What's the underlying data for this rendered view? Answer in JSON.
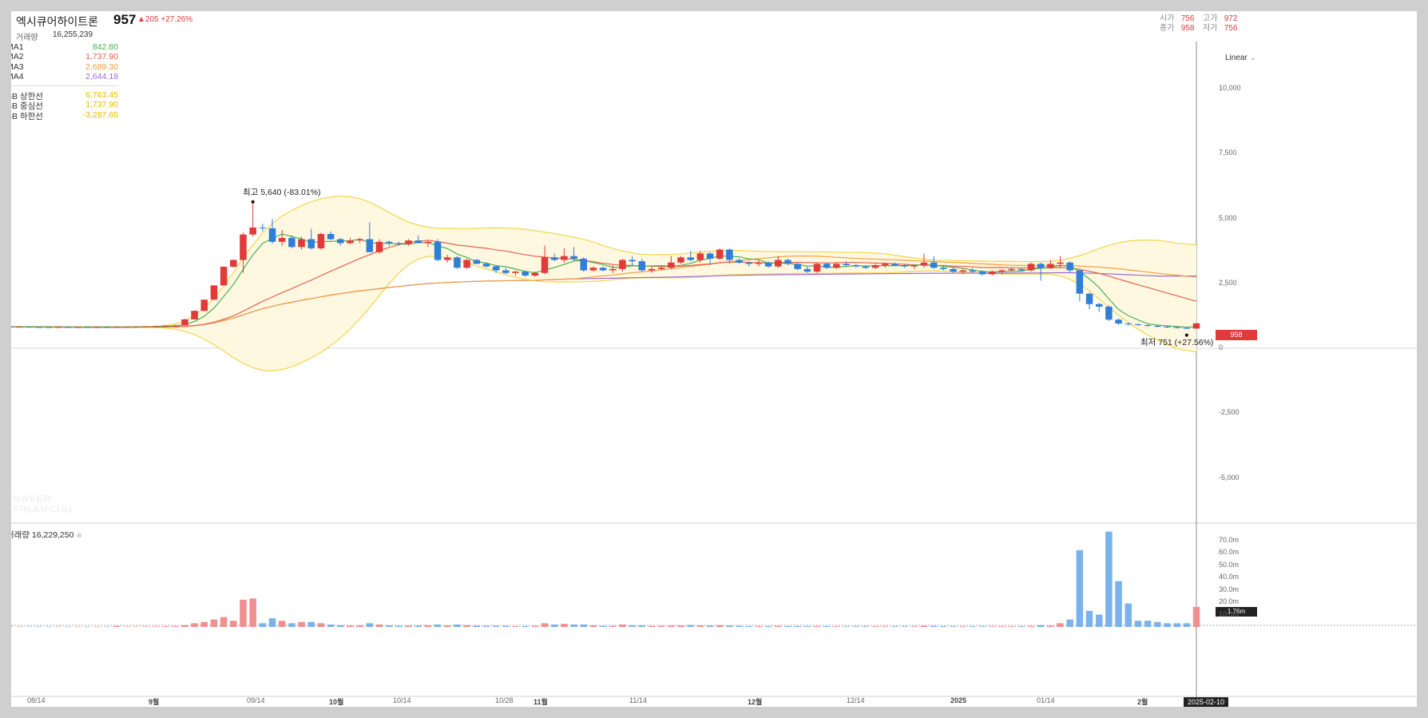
{
  "header": {
    "name": "엑시큐어하이트론",
    "price": "957",
    "change": "▲205 +27.26%",
    "volume_label": "거래량",
    "volume_value": "16,255,239",
    "open_label": "시가",
    "open": "756",
    "high_label": "고가",
    "high": "972",
    "close_label": "종가",
    "close": "958",
    "low_label": "저가",
    "low": "756"
  },
  "legend": {
    "ma": [
      {
        "label": "MA1",
        "value": "842.80",
        "color": "#4caf50"
      },
      {
        "label": "MA2",
        "value": "1,737.90",
        "color": "#e8604c"
      },
      {
        "label": "MA3",
        "value": "2,689.30",
        "color": "#f0a040"
      },
      {
        "label": "MA4",
        "value": "2,644.18",
        "color": "#9b6ad8"
      }
    ],
    "bb": [
      {
        "label": "BB 상한선",
        "value": "6,763.45",
        "color": "#e6b800"
      },
      {
        "label": "BB 중심선",
        "value": "1,737.90",
        "color": "#e6b800"
      },
      {
        "label": "BB 하한선",
        "value": "-3,287.65",
        "color": "#e6b800"
      }
    ]
  },
  "watermark": [
    "NAVER",
    "FINANCIAL"
  ],
  "annotations": {
    "high_note": "최고 5,640 (-83.01%)",
    "low_note": "최저 751 (+27.56%)"
  },
  "scale_mode": "Linear",
  "price_tag": "958",
  "volume_tag": "1.76m",
  "date_tag": "2025-02-10",
  "volume_panel_label": "거래량 16,229,250",
  "colors": {
    "up": "#e03a3a",
    "down": "#2f7ed8",
    "up_vol": "#f08f8f",
    "down_vol": "#7ab3ec",
    "band_fill": "#fff8e1",
    "band_line": "#f5d547"
  },
  "price_axis": [
    "10,000",
    "7,500",
    "5,000",
    "2,500",
    "0",
    "-2,500",
    "-5,000"
  ],
  "volume_axis": [
    "70.0m",
    "60.0m",
    "50.0m",
    "40.0m",
    "30.0m",
    "20.0m",
    "10.0m"
  ],
  "x_axis": [
    {
      "label": "08/14",
      "bold": false
    },
    {
      "label": "9월",
      "bold": true
    },
    {
      "label": "09/14",
      "bold": false
    },
    {
      "label": "10월",
      "bold": true
    },
    {
      "label": "10/14",
      "bold": false
    },
    {
      "label": "10/28",
      "bold": false
    },
    {
      "label": "11월",
      "bold": true
    },
    {
      "label": "11/14",
      "bold": false
    },
    {
      "label": "12월",
      "bold": true
    },
    {
      "label": "12/14",
      "bold": false
    },
    {
      "label": "2025",
      "bold": true
    },
    {
      "label": "01/14",
      "bold": false
    },
    {
      "label": "2월",
      "bold": true
    }
  ],
  "chart_data": {
    "type": "candlestick",
    "title": "엑시큐어하이트론",
    "y_range": [
      -6000,
      11000
    ],
    "volume_range_m": [
      0,
      78
    ],
    "candles": [
      {
        "o": 830,
        "h": 840,
        "l": 820,
        "c": 828,
        "v": 0.5
      },
      {
        "o": 828,
        "h": 835,
        "l": 815,
        "c": 820,
        "v": 0.4
      },
      {
        "o": 820,
        "h": 830,
        "l": 812,
        "c": 825,
        "v": 0.3
      },
      {
        "o": 825,
        "h": 832,
        "l": 815,
        "c": 818,
        "v": 0.3
      },
      {
        "o": 818,
        "h": 826,
        "l": 808,
        "c": 815,
        "v": 0.3
      },
      {
        "o": 815,
        "h": 822,
        "l": 805,
        "c": 812,
        "v": 0.2
      },
      {
        "o": 812,
        "h": 820,
        "l": 802,
        "c": 816,
        "v": 0.3
      },
      {
        "o": 816,
        "h": 824,
        "l": 806,
        "c": 810,
        "v": 0.2
      },
      {
        "o": 810,
        "h": 818,
        "l": 800,
        "c": 814,
        "v": 0.2
      },
      {
        "o": 814,
        "h": 820,
        "l": 804,
        "c": 808,
        "v": 0.2
      },
      {
        "o": 808,
        "h": 815,
        "l": 800,
        "c": 812,
        "v": 0.2
      },
      {
        "o": 812,
        "h": 818,
        "l": 803,
        "c": 806,
        "v": 0.2
      },
      {
        "o": 806,
        "h": 820,
        "l": 800,
        "c": 815,
        "v": 0.8
      },
      {
        "o": 815,
        "h": 825,
        "l": 805,
        "c": 820,
        "v": 0.3
      },
      {
        "o": 820,
        "h": 832,
        "l": 812,
        "c": 826,
        "v": 0.3
      },
      {
        "o": 826,
        "h": 845,
        "l": 818,
        "c": 838,
        "v": 0.4
      },
      {
        "o": 838,
        "h": 860,
        "l": 830,
        "c": 852,
        "v": 0.4
      },
      {
        "o": 852,
        "h": 880,
        "l": 840,
        "c": 870,
        "v": 0.5
      },
      {
        "o": 870,
        "h": 900,
        "l": 858,
        "c": 880,
        "v": 0.6
      },
      {
        "o": 880,
        "h": 1140,
        "l": 870,
        "c": 1110,
        "v": 1.5
      },
      {
        "o": 1110,
        "h": 1450,
        "l": 1100,
        "c": 1440,
        "v": 3.0
      },
      {
        "o": 1440,
        "h": 1880,
        "l": 1430,
        "c": 1870,
        "v": 4.0
      },
      {
        "o": 1870,
        "h": 2430,
        "l": 1860,
        "c": 2420,
        "v": 6.0
      },
      {
        "o": 2420,
        "h": 3150,
        "l": 2410,
        "c": 3140,
        "v": 8.0
      },
      {
        "o": 3140,
        "h": 3420,
        "l": 3100,
        "c": 3400,
        "v": 5.0
      },
      {
        "o": 3400,
        "h": 4450,
        "l": 2900,
        "c": 4380,
        "v": 22.0
      },
      {
        "o": 4380,
        "h": 5640,
        "l": 4300,
        "c": 4650,
        "v": 23.0
      },
      {
        "o": 4650,
        "h": 4800,
        "l": 4500,
        "c": 4620,
        "v": 3.0
      },
      {
        "o": 4620,
        "h": 4980,
        "l": 4020,
        "c": 4100,
        "v": 7.0
      },
      {
        "o": 4100,
        "h": 4550,
        "l": 3950,
        "c": 4250,
        "v": 5.0
      },
      {
        "o": 4250,
        "h": 4350,
        "l": 3850,
        "c": 3900,
        "v": 3.0
      },
      {
        "o": 3900,
        "h": 4300,
        "l": 3800,
        "c": 4200,
        "v": 4.0
      },
      {
        "o": 4200,
        "h": 4600,
        "l": 3800,
        "c": 3850,
        "v": 4.0
      },
      {
        "o": 3850,
        "h": 4450,
        "l": 3800,
        "c": 4400,
        "v": 3.0
      },
      {
        "o": 4400,
        "h": 4500,
        "l": 4150,
        "c": 4200,
        "v": 2.0
      },
      {
        "o": 4200,
        "h": 4250,
        "l": 3950,
        "c": 4050,
        "v": 1.5
      },
      {
        "o": 4050,
        "h": 4250,
        "l": 4000,
        "c": 4150,
        "v": 1.0
      },
      {
        "o": 4150,
        "h": 4250,
        "l": 4050,
        "c": 4200,
        "v": 1.2
      },
      {
        "o": 4200,
        "h": 4850,
        "l": 4000,
        "c": 3700,
        "v": 3.0
      },
      {
        "o": 3700,
        "h": 4200,
        "l": 3650,
        "c": 4100,
        "v": 2.0
      },
      {
        "o": 4100,
        "h": 4150,
        "l": 3950,
        "c": 4050,
        "v": 1.2
      },
      {
        "o": 4050,
        "h": 4100,
        "l": 3950,
        "c": 4020,
        "v": 0.8
      },
      {
        "o": 4020,
        "h": 4200,
        "l": 3950,
        "c": 4150,
        "v": 1.0
      },
      {
        "o": 4150,
        "h": 4350,
        "l": 4050,
        "c": 4050,
        "v": 1.0
      },
      {
        "o": 4050,
        "h": 4150,
        "l": 3900,
        "c": 4100,
        "v": 1.5
      },
      {
        "o": 4100,
        "h": 4200,
        "l": 3350,
        "c": 3400,
        "v": 2.0
      },
      {
        "o": 3400,
        "h": 3600,
        "l": 3300,
        "c": 3500,
        "v": 1.2
      },
      {
        "o": 3500,
        "h": 3550,
        "l": 3050,
        "c": 3100,
        "v": 2.0
      },
      {
        "o": 3100,
        "h": 3450,
        "l": 3050,
        "c": 3400,
        "v": 1.5
      },
      {
        "o": 3400,
        "h": 3450,
        "l": 3250,
        "c": 3250,
        "v": 1.0
      },
      {
        "o": 3250,
        "h": 3300,
        "l": 3100,
        "c": 3150,
        "v": 0.8
      },
      {
        "o": 3150,
        "h": 3200,
        "l": 2900,
        "c": 3000,
        "v": 0.8
      },
      {
        "o": 3000,
        "h": 3100,
        "l": 2850,
        "c": 2900,
        "v": 0.8
      },
      {
        "o": 2900,
        "h": 3000,
        "l": 2800,
        "c": 2950,
        "v": 0.6
      },
      {
        "o": 2950,
        "h": 3000,
        "l": 2750,
        "c": 2800,
        "v": 0.6
      },
      {
        "o": 2800,
        "h": 2950,
        "l": 2750,
        "c": 2900,
        "v": 0.8
      },
      {
        "o": 2900,
        "h": 3950,
        "l": 2850,
        "c": 3500,
        "v": 3.0
      },
      {
        "o": 3500,
        "h": 3650,
        "l": 3350,
        "c": 3400,
        "v": 2.0
      },
      {
        "o": 3400,
        "h": 3850,
        "l": 3300,
        "c": 3550,
        "v": 2.5
      },
      {
        "o": 3550,
        "h": 3900,
        "l": 3350,
        "c": 3450,
        "v": 2.0
      },
      {
        "o": 3450,
        "h": 3500,
        "l": 2950,
        "c": 3000,
        "v": 2.0
      },
      {
        "o": 3000,
        "h": 3150,
        "l": 2950,
        "c": 3100,
        "v": 1.2
      },
      {
        "o": 3100,
        "h": 3150,
        "l": 2950,
        "c": 3000,
        "v": 0.8
      },
      {
        "o": 3000,
        "h": 3200,
        "l": 2900,
        "c": 3050,
        "v": 0.8
      },
      {
        "o": 3050,
        "h": 3450,
        "l": 2950,
        "c": 3400,
        "v": 2.0
      },
      {
        "o": 3400,
        "h": 3550,
        "l": 3150,
        "c": 3350,
        "v": 1.2
      },
      {
        "o": 3350,
        "h": 3450,
        "l": 2950,
        "c": 3000,
        "v": 1.2
      },
      {
        "o": 3000,
        "h": 3150,
        "l": 2900,
        "c": 3050,
        "v": 0.8
      },
      {
        "o": 3050,
        "h": 3150,
        "l": 3000,
        "c": 3100,
        "v": 0.8
      },
      {
        "o": 3100,
        "h": 3550,
        "l": 3050,
        "c": 3300,
        "v": 1.0
      },
      {
        "o": 3300,
        "h": 3550,
        "l": 3250,
        "c": 3500,
        "v": 1.2
      },
      {
        "o": 3500,
        "h": 3750,
        "l": 3350,
        "c": 3400,
        "v": 1.5
      },
      {
        "o": 3400,
        "h": 3750,
        "l": 3300,
        "c": 3650,
        "v": 1.2
      },
      {
        "o": 3650,
        "h": 3700,
        "l": 3200,
        "c": 3450,
        "v": 1.0
      },
      {
        "o": 3450,
        "h": 3850,
        "l": 3400,
        "c": 3800,
        "v": 1.5
      },
      {
        "o": 3800,
        "h": 3850,
        "l": 3250,
        "c": 3400,
        "v": 1.0
      },
      {
        "o": 3400,
        "h": 3450,
        "l": 3250,
        "c": 3300,
        "v": 0.8
      },
      {
        "o": 3300,
        "h": 3350,
        "l": 3150,
        "c": 3250,
        "v": 0.6
      },
      {
        "o": 3250,
        "h": 3400,
        "l": 3150,
        "c": 3300,
        "v": 0.6
      },
      {
        "o": 3300,
        "h": 3350,
        "l": 3100,
        "c": 3150,
        "v": 0.6
      },
      {
        "o": 3150,
        "h": 3550,
        "l": 3100,
        "c": 3400,
        "v": 0.8
      },
      {
        "o": 3400,
        "h": 3450,
        "l": 3200,
        "c": 3250,
        "v": 0.6
      },
      {
        "o": 3250,
        "h": 3300,
        "l": 3000,
        "c": 3050,
        "v": 0.6
      },
      {
        "o": 3050,
        "h": 3150,
        "l": 2900,
        "c": 2950,
        "v": 0.6
      },
      {
        "o": 2950,
        "h": 3300,
        "l": 2900,
        "c": 3250,
        "v": 0.6
      },
      {
        "o": 3250,
        "h": 3300,
        "l": 3050,
        "c": 3100,
        "v": 0.6
      },
      {
        "o": 3100,
        "h": 3300,
        "l": 3050,
        "c": 3250,
        "v": 0.5
      },
      {
        "o": 3250,
        "h": 3350,
        "l": 3150,
        "c": 3200,
        "v": 0.5
      },
      {
        "o": 3200,
        "h": 3250,
        "l": 3100,
        "c": 3150,
        "v": 0.5
      },
      {
        "o": 3150,
        "h": 3200,
        "l": 3050,
        "c": 3100,
        "v": 0.5
      },
      {
        "o": 3100,
        "h": 3250,
        "l": 3050,
        "c": 3200,
        "v": 0.5
      },
      {
        "o": 3200,
        "h": 3300,
        "l": 3100,
        "c": 3250,
        "v": 0.5
      },
      {
        "o": 3250,
        "h": 3300,
        "l": 3150,
        "c": 3200,
        "v": 0.5
      },
      {
        "o": 3200,
        "h": 3250,
        "l": 3100,
        "c": 3150,
        "v": 0.5
      },
      {
        "o": 3150,
        "h": 3250,
        "l": 3050,
        "c": 3200,
        "v": 0.5
      },
      {
        "o": 3200,
        "h": 3650,
        "l": 3100,
        "c": 3300,
        "v": 1.0
      },
      {
        "o": 3300,
        "h": 3550,
        "l": 3050,
        "c": 3100,
        "v": 0.8
      },
      {
        "o": 3100,
        "h": 3200,
        "l": 3000,
        "c": 3050,
        "v": 0.6
      },
      {
        "o": 3050,
        "h": 3100,
        "l": 2900,
        "c": 2950,
        "v": 0.5
      },
      {
        "o": 2950,
        "h": 3050,
        "l": 2850,
        "c": 3000,
        "v": 0.5
      },
      {
        "o": 3000,
        "h": 3100,
        "l": 2900,
        "c": 2950,
        "v": 0.5
      },
      {
        "o": 2950,
        "h": 3000,
        "l": 2800,
        "c": 2850,
        "v": 0.5
      },
      {
        "o": 2850,
        "h": 3000,
        "l": 2800,
        "c": 2950,
        "v": 0.5
      },
      {
        "o": 2950,
        "h": 3050,
        "l": 2850,
        "c": 3000,
        "v": 0.5
      },
      {
        "o": 3000,
        "h": 3100,
        "l": 2950,
        "c": 3050,
        "v": 0.5
      },
      {
        "o": 3050,
        "h": 3100,
        "l": 2950,
        "c": 3000,
        "v": 0.5
      },
      {
        "o": 3000,
        "h": 3300,
        "l": 2950,
        "c": 3250,
        "v": 0.6
      },
      {
        "o": 3250,
        "h": 3300,
        "l": 2600,
        "c": 3100,
        "v": 1.5
      },
      {
        "o": 3100,
        "h": 3400,
        "l": 3050,
        "c": 3250,
        "v": 1.0
      },
      {
        "o": 3250,
        "h": 3550,
        "l": 3100,
        "c": 3300,
        "v": 3.0
      },
      {
        "o": 3300,
        "h": 3350,
        "l": 2900,
        "c": 3000,
        "v": 6.0
      },
      {
        "o": 3000,
        "h": 3050,
        "l": 1800,
        "c": 2100,
        "v": 62.0
      },
      {
        "o": 2100,
        "h": 2150,
        "l": 1500,
        "c": 1700,
        "v": 13.0
      },
      {
        "o": 1700,
        "h": 1750,
        "l": 1400,
        "c": 1600,
        "v": 10.0
      },
      {
        "o": 1600,
        "h": 1650,
        "l": 1050,
        "c": 1100,
        "v": 77.0
      },
      {
        "o": 1100,
        "h": 1150,
        "l": 900,
        "c": 950,
        "v": 37.0
      },
      {
        "o": 950,
        "h": 1000,
        "l": 880,
        "c": 920,
        "v": 19.0
      },
      {
        "o": 920,
        "h": 960,
        "l": 860,
        "c": 890,
        "v": 5.0
      },
      {
        "o": 890,
        "h": 920,
        "l": 820,
        "c": 860,
        "v": 5.0
      },
      {
        "o": 860,
        "h": 900,
        "l": 800,
        "c": 830,
        "v": 4.0
      },
      {
        "o": 830,
        "h": 860,
        "l": 780,
        "c": 810,
        "v": 3.0
      },
      {
        "o": 810,
        "h": 840,
        "l": 760,
        "c": 780,
        "v": 3.0
      },
      {
        "o": 780,
        "h": 800,
        "l": 751,
        "c": 760,
        "v": 3.0
      },
      {
        "o": 756,
        "h": 972,
        "l": 756,
        "c": 958,
        "v": 16.2
      }
    ]
  }
}
